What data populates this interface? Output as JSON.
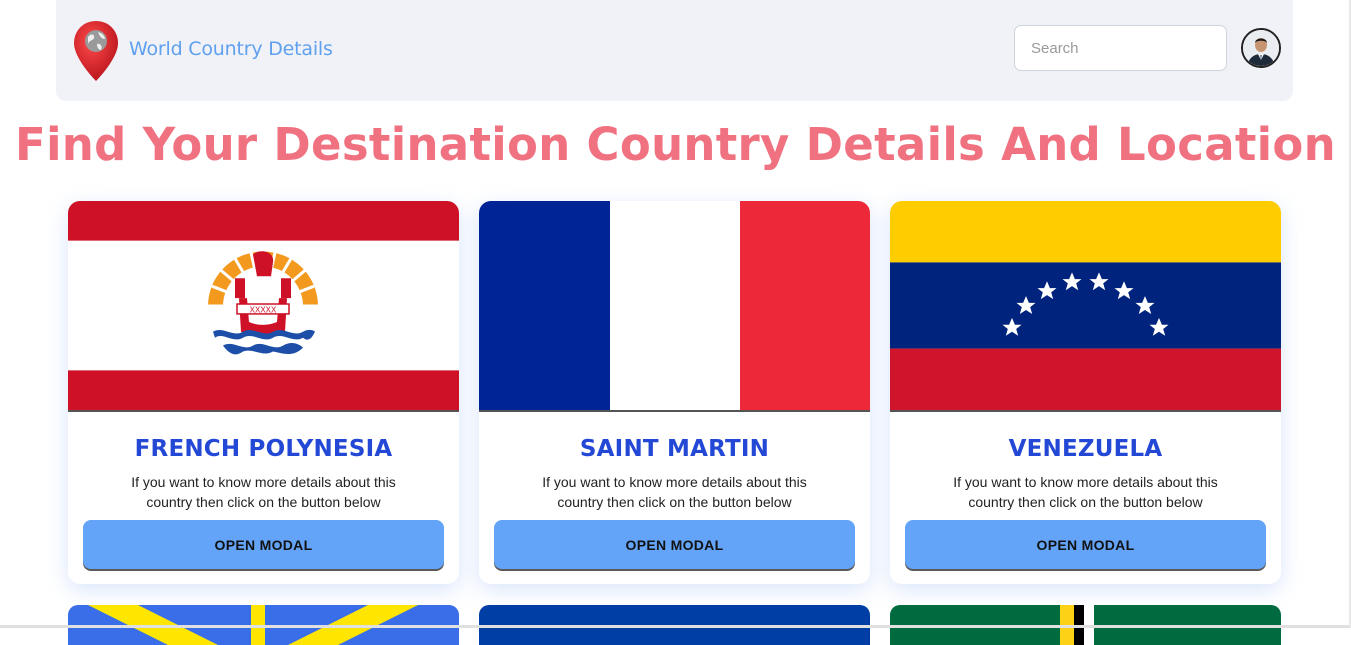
{
  "navbar": {
    "brand": "World Country Details",
    "search_placeholder": "Search"
  },
  "headline": "Find Your Destination Country Details And Location",
  "cards": [
    {
      "name": "FRENCH POLYNESIA",
      "desc": "If you want to know more details about this country then click on the button below",
      "button": "OPEN MODAL"
    },
    {
      "name": "SAINT MARTIN",
      "desc": "If you want to know more details about this country then click on the button below",
      "button": "OPEN MODAL"
    },
    {
      "name": "VENEZUELA",
      "desc": "If you want to know more details about this country then click on the button below",
      "button": "OPEN MODAL"
    }
  ],
  "colors": {
    "brand": "#5fa0ef",
    "headline": "#f07180",
    "country_name": "#2448d6",
    "button": "#63a4f8",
    "navbar_bg": "#f0f2f7"
  },
  "icons": [
    "map-pin-globe-icon",
    "avatar"
  ]
}
